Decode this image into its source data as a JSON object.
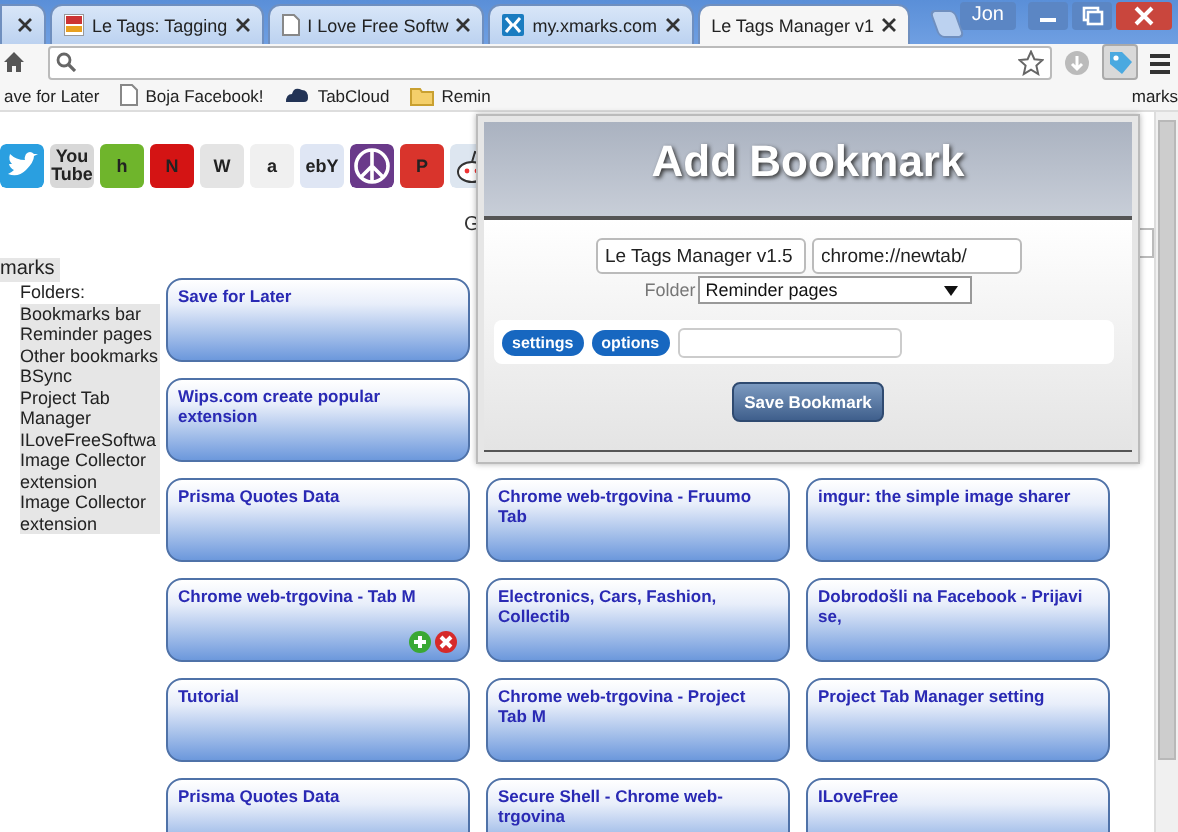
{
  "browser": {
    "tabs": [
      {
        "selected": false
      },
      {
        "title": "Le Tags: Tagging",
        "selected": false,
        "kind": "doc"
      },
      {
        "title": "I Love Free Softw",
        "selected": false,
        "kind": "page"
      },
      {
        "title": "my.xmarks.com",
        "selected": false,
        "kind": "xmarks"
      },
      {
        "title": "Le Tags Manager v1",
        "selected": true,
        "kind": "none"
      }
    ],
    "user": "Jon",
    "bookmarks_bar": [
      {
        "label": "ave for Later",
        "kind": "none"
      },
      {
        "label": "Boja Facebook!",
        "kind": "page"
      },
      {
        "label": "TabCloud",
        "kind": "cloud"
      },
      {
        "label": "Remin",
        "kind": "folder"
      }
    ],
    "bookmarks_bar_end": "marks"
  },
  "site_icons": [
    {
      "kind": "bird",
      "color": "#2a9fe0"
    },
    {
      "kind": "glyph",
      "text": "You Tube",
      "color": "#d8d8d8"
    },
    {
      "kind": "glyph",
      "text": "h",
      "color": "#6fb52c"
    },
    {
      "kind": "glyph",
      "text": "N",
      "color": "#d41414"
    },
    {
      "kind": "glyph",
      "text": "W",
      "color": "#e4e4e4"
    },
    {
      "kind": "glyph",
      "text": "a",
      "color": "#f0f0f0"
    },
    {
      "kind": "glyph",
      "text": "ebY",
      "color": "#dfe6f4"
    },
    {
      "kind": "peace",
      "color": "#6a3a8a"
    },
    {
      "kind": "glyph",
      "text": "P",
      "color": "#d9342c"
    },
    {
      "kind": "alien",
      "color": "#dde6f0"
    }
  ],
  "partial_label": "G",
  "sidebar": {
    "heading": "marks",
    "folders_label": "Folders:",
    "folders": [
      "Bookmarks bar",
      "Reminder pages",
      "Other bookmarks",
      "BSync",
      "Project Tab Manager",
      "ILoveFreeSoftwa",
      "Image Collector extension",
      "Image Collector extension"
    ]
  },
  "card_rows": [
    {
      "cards": [
        {
          "title": "Save for Later",
          "actions": false
        }
      ]
    },
    {
      "cards": [
        {
          "title": "Wips.com create popular extension",
          "actions": false
        }
      ]
    },
    {
      "cards": [
        {
          "title": "Prisma Quotes Data",
          "actions": false
        },
        {
          "title": "Chrome web-trgovina - Fruumo Tab",
          "actions": false
        },
        {
          "title": "imgur: the simple image sharer",
          "actions": false
        }
      ]
    },
    {
      "cards": [
        {
          "title": "Chrome web-trgovina - Tab M",
          "actions": true
        },
        {
          "title": "Electronics, Cars, Fashion, Collectib",
          "actions": false
        },
        {
          "title": "Dobrodošli na Facebook - Prijavi se,",
          "actions": false
        }
      ]
    },
    {
      "cards": [
        {
          "title": "Tutorial",
          "actions": false
        },
        {
          "title": "Chrome web-trgovina - Project Tab M",
          "actions": false
        },
        {
          "title": "Project Tab Manager setting",
          "actions": false
        }
      ]
    },
    {
      "cards": [
        {
          "title": "Prisma Quotes Data",
          "actions": false
        },
        {
          "title": "Secure Shell - Chrome web-trgovina",
          "actions": false
        },
        {
          "title": "ILoveFree",
          "actions": false
        }
      ]
    }
  ],
  "popup": {
    "title": "Add Bookmark",
    "name_value": "Le Tags Manager v1.5",
    "url_value": "chrome://newtab/",
    "folder_label": "Folder",
    "folder_value": "Reminder pages",
    "tags": [
      "settings",
      "options"
    ],
    "save_button": "Save Bookmark"
  }
}
